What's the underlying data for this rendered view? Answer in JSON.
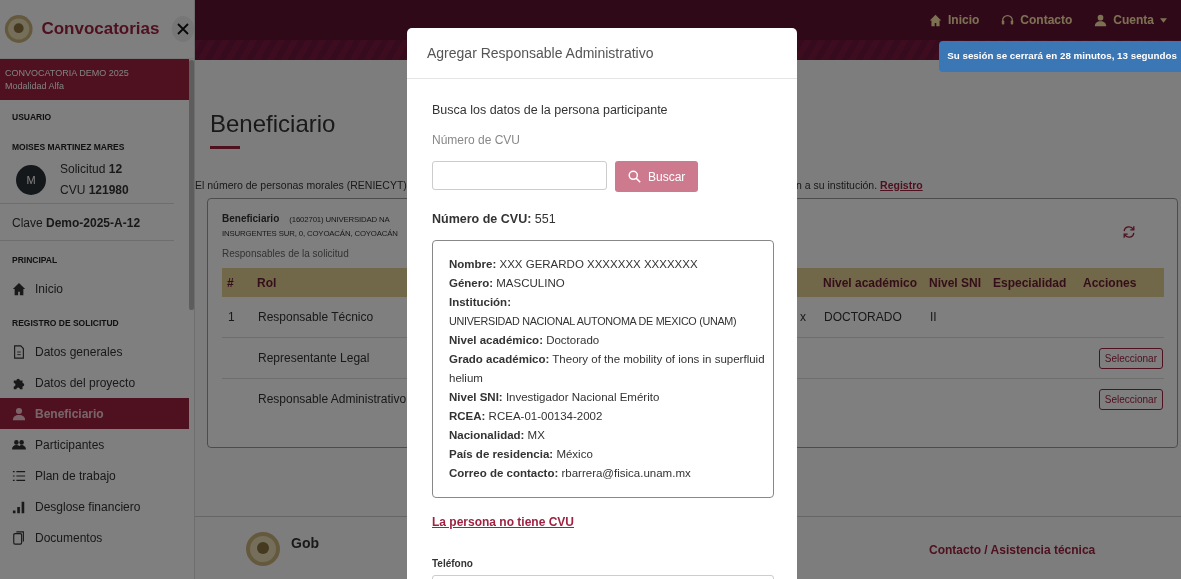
{
  "sidebar": {
    "title": "Convocatorias",
    "banner": {
      "title": "CONVOCATORIA DEMO 2025",
      "subtitle": "Modalidad Alfa"
    },
    "user_heading": "USUARIO",
    "user_name": "MOISES MARTINEZ MARES",
    "avatar_initial": "M",
    "solicitud": "Solicitud **12**",
    "cvu": "CVU **121980**",
    "clave": "Clave **Demo-2025-A-12**",
    "sections": [
      {
        "heading": "PRINCIPAL",
        "items": [
          {
            "label": "Inicio",
            "selected": false
          }
        ]
      },
      {
        "heading": "REGISTRO DE SOLICITUD",
        "items": [
          {
            "label": "Datos generales",
            "selected": false
          },
          {
            "label": "Datos del proyecto",
            "selected": false
          },
          {
            "label": "Beneficiario",
            "selected": true
          },
          {
            "label": "Participantes",
            "selected": false
          },
          {
            "label": "Plan de trabajo",
            "selected": false
          },
          {
            "label": "Desglose financiero",
            "selected": false
          },
          {
            "label": "Documentos",
            "selected": false
          }
        ]
      }
    ]
  },
  "top_nav": [
    {
      "label": "Inicio",
      "dropdown": false
    },
    {
      "label": "Contacto",
      "dropdown": false
    },
    {
      "label": "Cuenta",
      "dropdown": true
    }
  ],
  "session_alert": "Su sesión se cerrará en 28 minutos, 13 segundos",
  "page": {
    "title": "Beneficiario",
    "notice": {
      "text_start": "El número de personas morales (RENIECYT)",
      "text_end": "n a su institución.",
      "link": "Registro"
    },
    "card": {
      "label": "Beneficiario",
      "details_line_1": "(1602701) UNIVERSIDAD NA",
      "details_line_2": "INSURGENTES SUR, 0, COYOACÁN, COYOACÁN",
      "subtitle": "Responsables de la solicitud",
      "table": {
        "columns": [
          "#",
          "Rol",
          "Nivel académico",
          "Nivel SNI",
          "Especialidad",
          "Acciones"
        ],
        "rows": [
          {
            "number": "1",
            "role": "Responsable Técnico",
            "column_3": "x",
            "nivel_academico": "DOCTORADO",
            "nivel_sni": "II"
          },
          {
            "role": "Representante Legal",
            "action": "Seleccionar"
          },
          {
            "role": "Responsable Administrativo",
            "action": "Seleccionar"
          }
        ]
      }
    }
  },
  "footer": {
    "logo_text": "Gob",
    "contact_link": "Contacto / Asistencia técnica"
  },
  "modal": {
    "title": "Agregar Responsable Administrativo",
    "prompt": "Busca los datos de la persona participante",
    "cvu_label": "Número de CVU",
    "search_button": "Buscar",
    "result": "**Número de CVU:** 551",
    "details": [
      {
        "kind": "inline",
        "text": "**Nombre:**  XXX GERARDO XXXXXXX XXXXXXX"
      },
      {
        "kind": "inline",
        "text": "**Género:**  MASCULINO"
      },
      {
        "kind": "block",
        "label": "Institución:",
        "value": "UNIVERSIDAD NACIONAL AUTONOMA DE MEXICO (UNAM)"
      },
      {
        "kind": "inline",
        "text": "**Nivel académico:**  Doctorado"
      },
      {
        "kind": "inline",
        "text": "**Grado académico:**  Theory of the mobility of ions in superfluid helium"
      },
      {
        "kind": "inline",
        "text": "**Nivel SNI:**  Investigador Nacional Emérito"
      },
      {
        "kind": "inline",
        "text": "**RCEA:**  RCEA-01-00134-2002"
      },
      {
        "kind": "inline",
        "text": "**Nacionalidad:**  MX"
      },
      {
        "kind": "inline",
        "text": "**País de residencia:**  México"
      },
      {
        "kind": "inline",
        "text": "**Correo de contacto:**  rbarrera@fisica.unam.mx"
      }
    ],
    "no_cvu_link": "La persona no tiene CVU",
    "phone_label": "Teléfono"
  }
}
